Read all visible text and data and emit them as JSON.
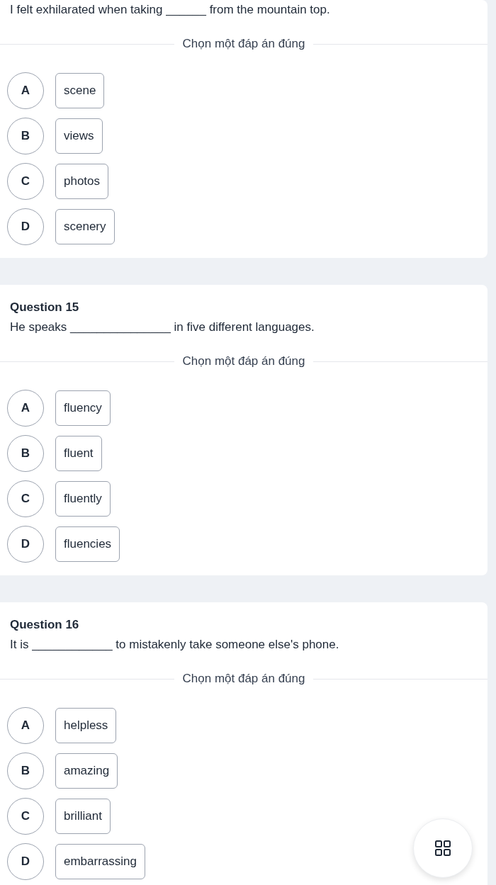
{
  "questions": [
    {
      "text": "I felt exhilarated when taking ______ from the mountain top.",
      "prompt": "Chọn một đáp án đúng",
      "options": [
        {
          "letter": "A",
          "answer": "scene",
          "selected": false
        },
        {
          "letter": "B",
          "answer": "views",
          "selected": false
        },
        {
          "letter": "C",
          "answer": "photos",
          "selected": false
        },
        {
          "letter": "D",
          "answer": "scenery",
          "selected": false
        }
      ]
    },
    {
      "title": "Question 15",
      "text": "He speaks _______________ in five different languages.",
      "prompt": "Chọn một đáp án đúng",
      "options": [
        {
          "letter": "A",
          "answer": "fluency",
          "selected": false
        },
        {
          "letter": "B",
          "answer": "fluent",
          "selected": false
        },
        {
          "letter": "C",
          "answer": "fluently",
          "selected": false
        },
        {
          "letter": "D",
          "answer": "fluencies",
          "selected": false
        }
      ]
    },
    {
      "title": "Question 16",
      "text": "It is ____________ to mistakenly take someone else's phone.",
      "prompt": "Chọn một đáp án đúng",
      "options": [
        {
          "letter": "A",
          "answer": "helpless",
          "selected": false
        },
        {
          "letter": "B",
          "answer": "amazing",
          "selected": false
        },
        {
          "letter": "C",
          "answer": "brilliant",
          "selected": false
        },
        {
          "letter": "D",
          "answer": "embarrassing",
          "selected": false
        }
      ]
    }
  ]
}
